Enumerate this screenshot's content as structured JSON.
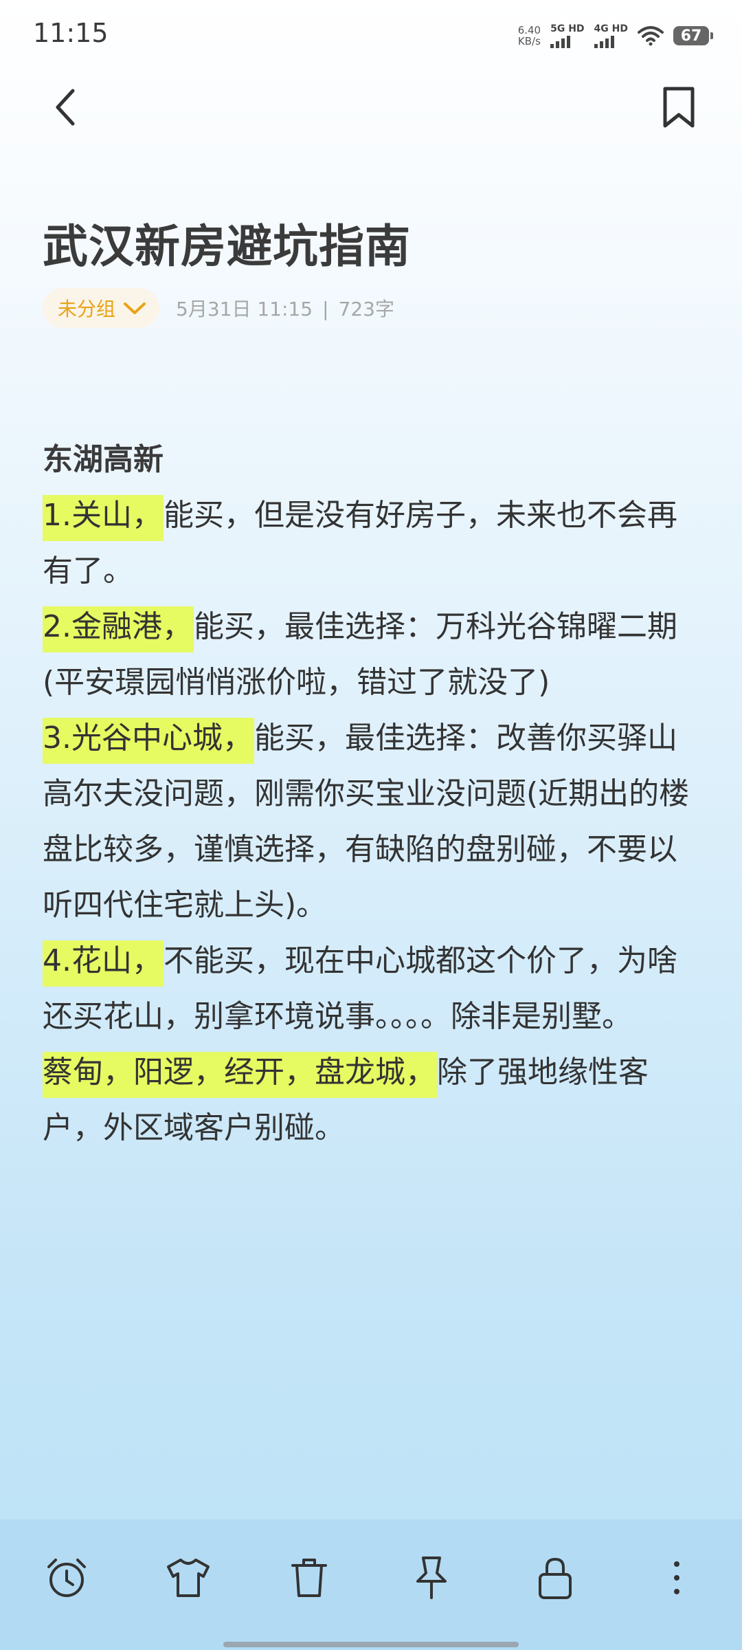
{
  "status_bar": {
    "time": "11:15",
    "net_speed_value": "6.40",
    "net_speed_unit": "KB/s",
    "signal_1": "5G HD",
    "signal_2": "4G HD",
    "battery": "67"
  },
  "top_bar": {
    "back_icon": "chevron-left-icon",
    "bookmark_icon": "bookmark-icon"
  },
  "note": {
    "title": "武汉新房避坑指南",
    "group": "未分组",
    "datetime": "5月31日 11:15",
    "separator": "|",
    "word_count": "723字",
    "section_heading": "东湖高新",
    "items": [
      {
        "highlight": "1.关山，",
        "text": "能买，但是没有好房子，未来也不会再有了。"
      },
      {
        "highlight": "2.金融港，",
        "text": "能买，最佳选择：万科光谷锦曜二期(平安璟园悄悄涨价啦，错过了就没了)"
      },
      {
        "highlight": "3.光谷中心城，",
        "text": "能买，最佳选择：改善你买驿山高尔夫没问题，刚需你买宝业没问题(近期出的楼盘比较多，谨慎选择，有缺陷的盘别碰，不要以听四代住宅就上头)。"
      },
      {
        "highlight": "4.花山，",
        "text": "不能买，现在中心城都这个价了，为啥还买花山，别拿环境说事。。。。除非是别墅。"
      },
      {
        "highlight": "蔡甸，阳逻，经开，盘龙城，",
        "text": "除了强地缘性客户，外区域客户别碰。"
      }
    ]
  },
  "bottom_toolbar": {
    "icons": [
      "alarm-clock-icon",
      "shirt-icon",
      "trash-icon",
      "pin-icon",
      "lock-icon",
      "more-vertical-icon"
    ]
  },
  "colors": {
    "highlight": "#e6fa62",
    "group_accent": "#e8a317",
    "meta_text": "#a6a6a6"
  }
}
